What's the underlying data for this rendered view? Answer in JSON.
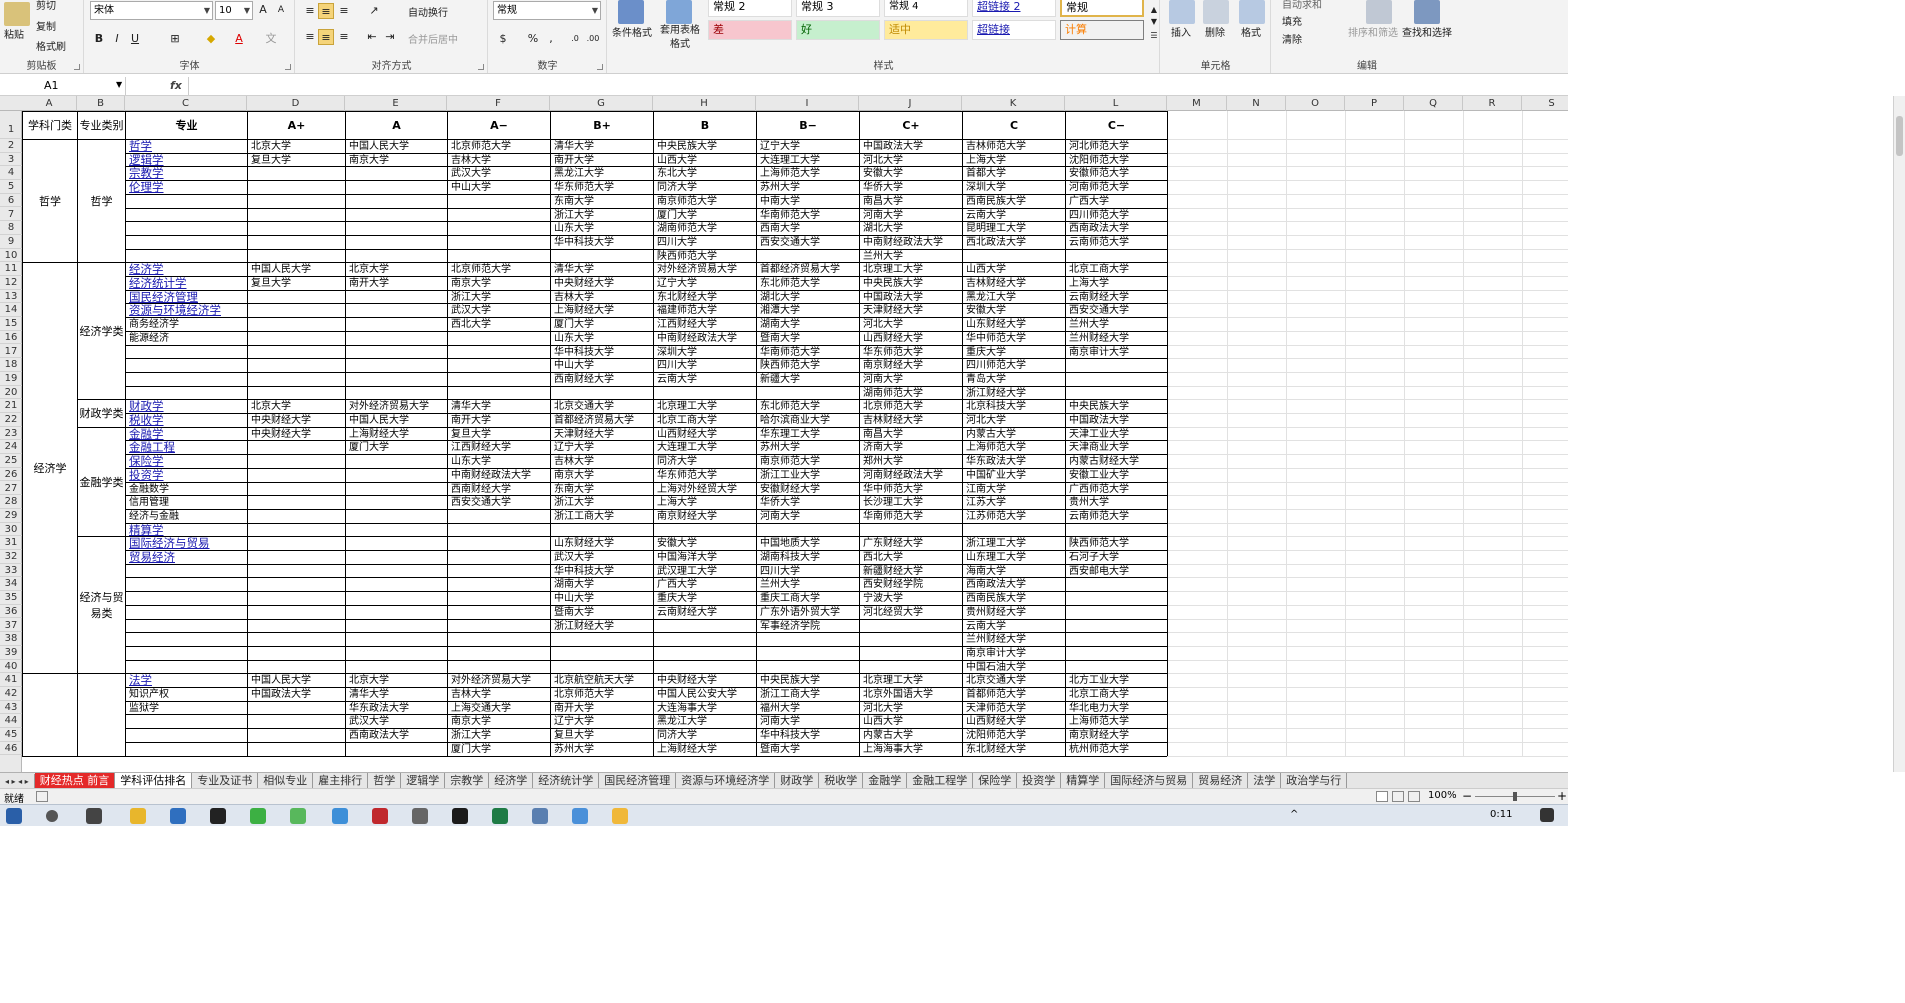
{
  "ribbon": {
    "clipboard": {
      "group": "剪贴板",
      "paste": "粘贴",
      "cut": "剪切",
      "copy": "复制",
      "format": "格式刷"
    },
    "font": {
      "group": "字体",
      "name": "宋体",
      "size": "10"
    },
    "align": {
      "group": "对齐方式",
      "wrap": "自动换行",
      "merge": "合并后居中"
    },
    "number": {
      "group": "数字",
      "format": "常规"
    },
    "styles": {
      "group": "样式",
      "cond": "条件格式",
      "table": "套用表格格式",
      "items": [
        "常规 2",
        "常规 3",
        "常规 4",
        "超链接 2",
        "常规",
        "差",
        "好",
        "适中",
        "超链接",
        "计算"
      ]
    },
    "cells": {
      "group": "单元格",
      "insert": "插入",
      "delete": "删除",
      "format": "格式"
    },
    "edit": {
      "group": "编辑",
      "autosum": "自动求和",
      "fill": "填充",
      "clear": "清除",
      "sort": "排序和筛选",
      "find": "查找和选择"
    }
  },
  "namebox": "A1",
  "fx": "fx",
  "columns": [
    "A",
    "B",
    "C",
    "D",
    "E",
    "F",
    "G",
    "H",
    "I",
    "J",
    "K",
    "L",
    "M",
    "N",
    "O",
    "P",
    "Q",
    "R",
    "S"
  ],
  "rows": [
    "1",
    "2",
    "3",
    "4",
    "5",
    "6",
    "7",
    "8",
    "9",
    "10",
    "11",
    "12",
    "13",
    "14",
    "15",
    "16",
    "17",
    "18",
    "19",
    "20",
    "21",
    "22",
    "23",
    "24",
    "25",
    "26",
    "27",
    "28",
    "29",
    "30",
    "31",
    "32",
    "33",
    "34",
    "35",
    "36",
    "37",
    "38",
    "39",
    "40",
    "41",
    "42",
    "43",
    "44",
    "45",
    "46"
  ],
  "headers": [
    "学科门类",
    "专业类别",
    "专业",
    "A+",
    "A",
    "A−",
    "B+",
    "B",
    "B−",
    "C+",
    "C",
    "C−"
  ],
  "groups_a": [
    "哲学",
    "经济学"
  ],
  "groups_b": [
    "哲学",
    "经济学类",
    "财政学类",
    "金融学类",
    "经济与贸易类"
  ],
  "majors": [
    [
      "哲学",
      1
    ],
    [
      "逻辑学",
      1
    ],
    [
      "宗教学",
      1
    ],
    [
      "伦理学",
      1
    ],
    [
      "经济学",
      1
    ],
    [
      "经济统计学",
      1
    ],
    [
      "国民经济管理",
      1
    ],
    [
      "资源与环境经济学",
      1
    ],
    [
      "商务经济学",
      0
    ],
    [
      "能源经济",
      0
    ],
    [
      "财政学",
      1
    ],
    [
      "税收学",
      1
    ],
    [
      "金融学",
      1
    ],
    [
      "金融工程",
      1
    ],
    [
      "保险学",
      1
    ],
    [
      "投资学",
      1
    ],
    [
      "金融数学",
      0
    ],
    [
      "信用管理",
      0
    ],
    [
      "经济与金融",
      0
    ],
    [
      "精算学",
      1
    ],
    [
      "国际经济与贸易",
      1
    ],
    [
      "贸易经济",
      1
    ],
    [
      "法学",
      1
    ],
    [
      "知识产权",
      0
    ],
    [
      "监狱学",
      0
    ]
  ],
  "cells": [
    [
      "北京大学",
      "中国人民大学",
      "北京师范大学",
      "清华大学",
      "中央民族大学",
      "辽宁大学",
      "中国政法大学",
      "吉林师范大学",
      "河北师范大学"
    ],
    [
      "复旦大学",
      "南京大学",
      "吉林大学",
      "南开大学",
      "山西大学",
      "大连理工大学",
      "河北大学",
      "上海大学",
      "沈阳师范大学"
    ],
    [
      "",
      "",
      "武汉大学",
      "黑龙江大学",
      "东北大学",
      "上海师范大学",
      "安徽大学",
      "首都大学",
      "安徽师范大学"
    ],
    [
      "",
      "",
      "中山大学",
      "华东师范大学",
      "同济大学",
      "苏州大学",
      "华侨大学",
      "深圳大学",
      "河南师范大学"
    ],
    [
      "",
      "",
      "",
      "东南大学",
      "南京师范大学",
      "中南大学",
      "南昌大学",
      "西南民族大学",
      "广西大学"
    ],
    [
      "",
      "",
      "",
      "浙江大学",
      "厦门大学",
      "华南师范大学",
      "河南大学",
      "云南大学",
      "四川师范大学"
    ],
    [
      "",
      "",
      "",
      "山东大学",
      "湖南师范大学",
      "西南大学",
      "湖北大学",
      "昆明理工大学",
      "西南政法大学"
    ],
    [
      "",
      "",
      "",
      "华中科技大学",
      "四川大学",
      "西安交通大学",
      "中南财经政法大学",
      "西北政法大学",
      "云南师范大学"
    ],
    [
      "",
      "",
      "",
      "",
      "陕西师范大学",
      "",
      "兰州大学",
      "",
      ""
    ],
    [
      "中国人民大学",
      "北京大学",
      "北京师范大学",
      "清华大学",
      "对外经济贸易大学",
      "首都经济贸易大学",
      "北京理工大学",
      "山西大学",
      "北京工商大学"
    ],
    [
      "复旦大学",
      "南开大学",
      "南京大学",
      "中央财经大学",
      "辽宁大学",
      "东北师范大学",
      "中央民族大学",
      "吉林财经大学",
      "上海大学"
    ],
    [
      "",
      "",
      "浙江大学",
      "吉林大学",
      "东北财经大学",
      "湖北大学",
      "中国政法大学",
      "黑龙江大学",
      "云南财经大学"
    ],
    [
      "",
      "",
      "武汉大学",
      "上海财经大学",
      "福建师范大学",
      "湘潭大学",
      "天津财经大学",
      "安徽大学",
      "西安交通大学"
    ],
    [
      "",
      "",
      "西北大学",
      "厦门大学",
      "江西财经大学",
      "湖南大学",
      "河北大学",
      "山东财经大学",
      "兰州大学"
    ],
    [
      "",
      "",
      "",
      "山东大学",
      "中南财经政法大学",
      "暨南大学",
      "山西财经大学",
      "华中师范大学",
      "兰州财经大学"
    ],
    [
      "",
      "",
      "",
      "华中科技大学",
      "深圳大学",
      "华南师范大学",
      "华东师范大学",
      "重庆大学",
      "南京审计大学"
    ],
    [
      "",
      "",
      "",
      "中山大学",
      "四川大学",
      "陕西师范大学",
      "南京财经大学",
      "四川师范大学",
      ""
    ],
    [
      "",
      "",
      "",
      "西南财经大学",
      "云南大学",
      "新疆大学",
      "河南大学",
      "青岛大学",
      ""
    ],
    [
      "",
      "",
      "",
      "",
      "",
      "",
      "湖南师范大学",
      "浙江财经大学",
      ""
    ],
    [
      "北京大学",
      "对外经济贸易大学",
      "清华大学",
      "北京交通大学",
      "北京理工大学",
      "东北师范大学",
      "北京师范大学",
      "北京科技大学",
      "中央民族大学"
    ],
    [
      "中央财经大学",
      "中国人民大学",
      "南开大学",
      "首都经济贸易大学",
      "北京工商大学",
      "哈尔滨商业大学",
      "吉林财经大学",
      "河北大学",
      "中国政法大学"
    ],
    [
      "中央财经大学",
      "上海财经大学",
      "复旦大学",
      "天津财经大学",
      "山西财经大学",
      "华东理工大学",
      "南昌大学",
      "内蒙古大学",
      "天津工业大学"
    ],
    [
      "",
      "厦门大学",
      "江西财经大学",
      "辽宁大学",
      "大连理工大学",
      "苏州大学",
      "济南大学",
      "上海师范大学",
      "天津商业大学"
    ],
    [
      "",
      "",
      "山东大学",
      "吉林大学",
      "同济大学",
      "南京师范大学",
      "郑州大学",
      "华东政法大学",
      "内蒙古财经大学"
    ],
    [
      "",
      "",
      "中南财经政法大学",
      "南京大学",
      "华东师范大学",
      "浙江工业大学",
      "河南财经政法大学",
      "中国矿业大学",
      "安徽工业大学"
    ],
    [
      "",
      "",
      "西南财经大学",
      "东南大学",
      "上海对外经贸大学",
      "安徽财经大学",
      "华中师范大学",
      "江南大学",
      "广西师范大学"
    ],
    [
      "",
      "",
      "西安交通大学",
      "浙江大学",
      "上海大学",
      "华侨大学",
      "长沙理工大学",
      "江苏大学",
      "贵州大学"
    ],
    [
      "",
      "",
      "",
      "浙江工商大学",
      "南京财经大学",
      "河南大学",
      "华南师范大学",
      "江苏师范大学",
      "云南师范大学"
    ],
    [
      "",
      "",
      "",
      "",
      "",
      "",
      "",
      "",
      ""
    ],
    [
      "",
      "",
      "",
      "山东财经大学",
      "安徽大学",
      "中国地质大学",
      "广东财经大学",
      "浙江理工大学",
      "陕西师范大学"
    ],
    [
      "",
      "",
      "",
      "武汉大学",
      "中国海洋大学",
      "湖南科技大学",
      "西北大学",
      "山东理工大学",
      "石河子大学"
    ],
    [
      "",
      "",
      "",
      "华中科技大学",
      "武汉理工大学",
      "四川大学",
      "新疆财经大学",
      "海南大学",
      "西安邮电大学"
    ],
    [
      "",
      "",
      "",
      "湖南大学",
      "广西大学",
      "兰州大学",
      "西安财经学院",
      "西南政法大学",
      ""
    ],
    [
      "",
      "",
      "",
      "中山大学",
      "重庆大学",
      "重庆工商大学",
      "宁波大学",
      "西南民族大学",
      ""
    ],
    [
      "",
      "",
      "",
      "暨南大学",
      "云南财经大学",
      "广东外语外贸大学",
      "河北经贸大学",
      "贵州财经大学",
      ""
    ],
    [
      "",
      "",
      "",
      "浙江财经大学",
      "",
      "军事经济学院",
      "",
      "云南大学",
      ""
    ],
    [
      "",
      "",
      "",
      "",
      "",
      "",
      "",
      "兰州财经大学",
      ""
    ],
    [
      "",
      "",
      "",
      "",
      "",
      "",
      "",
      "南京审计大学",
      ""
    ],
    [
      "",
      "",
      "",
      "",
      "",
      "",
      "",
      "中国石油大学",
      ""
    ],
    [
      "中国人民大学",
      "北京大学",
      "对外经济贸易大学",
      "北京航空航天大学",
      "中央财经大学",
      "中央民族大学",
      "北京理工大学",
      "北京交通大学",
      "北方工业大学"
    ],
    [
      "中国政法大学",
      "清华大学",
      "吉林大学",
      "北京师范大学",
      "中国人民公安大学",
      "浙江工商大学",
      "北京外国语大学",
      "首都师范大学",
      "北京工商大学"
    ],
    [
      "",
      "华东政法大学",
      "上海交通大学",
      "南开大学",
      "大连海事大学",
      "福州大学",
      "河北大学",
      "天津师范大学",
      "华北电力大学"
    ],
    [
      "",
      "武汉大学",
      "南京大学",
      "辽宁大学",
      "黑龙江大学",
      "河南大学",
      "山西大学",
      "山西财经大学",
      "上海师范大学"
    ],
    [
      "",
      "西南政法大学",
      "浙江大学",
      "复旦大学",
      "同济大学",
      "华中科技大学",
      "内蒙古大学",
      "沈阳师范大学",
      "南京财经大学"
    ],
    [
      "",
      "",
      "厦门大学",
      "苏州大学",
      "上海财经大学",
      "暨南大学",
      "上海海事大学",
      "东北财经大学",
      "杭州师范大学"
    ]
  ],
  "tabs": [
    "财经热点 前言",
    "学科评估排名",
    "专业及证书",
    "相似专业",
    "雇主排行",
    "哲学",
    "逻辑学",
    "宗教学",
    "经济学",
    "经济统计学",
    "国民经济管理",
    "资源与环境经济学",
    "财政学",
    "税收学",
    "金融学",
    "金融工程学",
    "保险学",
    "投资学",
    "精算学",
    "国际经济与贸易",
    "贸易经济",
    "法学",
    "政治学与行"
  ],
  "status": {
    "ready": "就绪",
    "zoom": "100%",
    "time": "0:11"
  }
}
